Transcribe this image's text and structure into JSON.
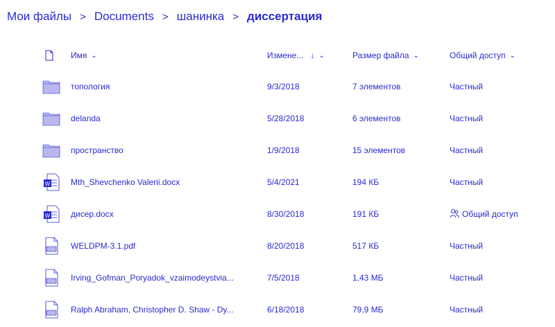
{
  "breadcrumb": {
    "items": [
      "Мои файлы",
      "Documents",
      "шанинка",
      "диссертация"
    ],
    "separator": ">"
  },
  "header": {
    "name": "Имя",
    "modified": "Измене...",
    "sort_arrow": "↓",
    "size": "Размер файла",
    "sharing": "Общий доступ",
    "chevron": "⌄"
  },
  "rows": [
    {
      "type": "folder-icon",
      "name": "топология",
      "modified": "9/3/2018",
      "size": "7 элементов",
      "sharing": "Частный"
    },
    {
      "type": "folder-icon",
      "name": "delanda",
      "modified": "5/28/2018",
      "size": "6 элементов",
      "sharing": "Частный"
    },
    {
      "type": "folder-icon",
      "name": "пространство",
      "modified": "1/9/2018",
      "size": "15 элементов",
      "sharing": "Частный"
    },
    {
      "type": "word-icon",
      "name": "Mth_Shevchenko Valerii.docx",
      "modified": "5/4/2021",
      "size": "194 КБ",
      "sharing": "Частный"
    },
    {
      "type": "word-icon",
      "name": "дисер.docx",
      "modified": "8/30/2018",
      "size": "191 КБ",
      "sharing": "Общий доступ"
    },
    {
      "type": "pdf-icon",
      "name": "WELDPM-3.1.pdf",
      "modified": "8/20/2018",
      "size": "517 КБ",
      "sharing": "Частный"
    },
    {
      "type": "pdf-icon",
      "name": "Irving_Gofman_Poryadok_vzaimodeystvia...",
      "modified": "7/5/2018",
      "size": "1,43 МБ",
      "sharing": "Частный"
    },
    {
      "type": "pdf-icon",
      "name": "Ralph Abraham, Christopher D. Shaw - Dy...",
      "modified": "6/18/2018",
      "size": "79,9 МБ",
      "sharing": "Частный"
    }
  ],
  "colors": {
    "text": "#2a2ad0"
  }
}
